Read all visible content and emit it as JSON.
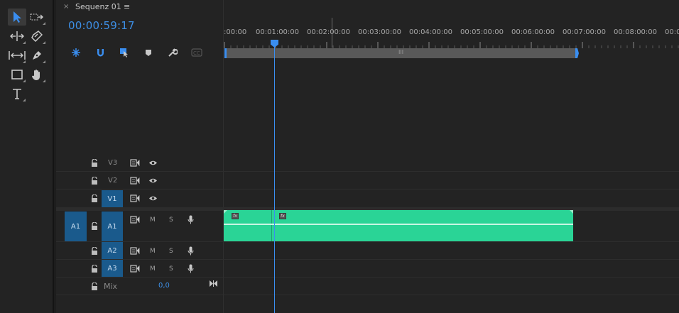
{
  "tools": [
    {
      "name": "selection-tool-icon",
      "active": true
    },
    {
      "name": "track-select-forward-icon"
    },
    {
      "name": "ripple-edit-tool-icon"
    },
    {
      "name": "razor-tool-icon"
    },
    {
      "name": "slip-tool-icon"
    },
    {
      "name": "pen-tool-icon"
    },
    {
      "name": "rectangle-tool-icon"
    },
    {
      "name": "hand-tool-icon"
    },
    {
      "name": "type-tool-icon"
    }
  ],
  "tab": {
    "close": "×",
    "title": "Sequenz 01",
    "menu": "≡"
  },
  "timecode": "00:00:59:17",
  "controls": [
    "nest-sequence-icon",
    "snap-magnet-icon",
    "linked-selection-icon",
    "add-marker-icon",
    "timeline-settings-wrench-icon",
    "captions-cc-icon"
  ],
  "ruler": {
    "labels": [
      ":00:00",
      "00:01:00:00",
      "00:02:00:00",
      "00:03:00:00",
      "00:04:00:00",
      "00:05:00:00",
      "00:06:00:00",
      "00:07:00:00",
      "00:08:00:00",
      "00:0"
    ]
  },
  "zoom_grip": "III",
  "video_tracks": [
    {
      "id": "V3",
      "target": false
    },
    {
      "id": "V2",
      "target": false
    },
    {
      "id": "V1",
      "target": true
    }
  ],
  "audio_tracks": [
    {
      "id": "A1",
      "source": "A1",
      "m": "M",
      "s": "S"
    },
    {
      "id": "A2",
      "m": "M",
      "s": "S"
    },
    {
      "id": "A3",
      "m": "M",
      "s": "S"
    }
  ],
  "mix": {
    "label": "Mix",
    "value": "0,0"
  },
  "clip": {
    "fx_label": "fx",
    "color": "#2ad496"
  },
  "accent": "#3a8ef0"
}
